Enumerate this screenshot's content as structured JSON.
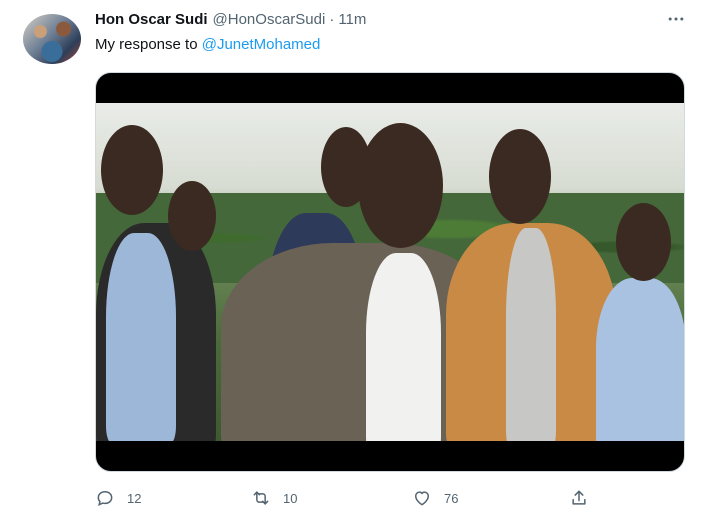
{
  "tweet": {
    "author_name": "Hon Oscar Sudi",
    "author_handle": "@HonOscarSudi",
    "separator": "·",
    "time": "11m",
    "text_prefix": "My response to ",
    "mention": "@JunetMohamed",
    "more_icon": "more-horizontal-icon"
  },
  "media": {
    "type": "video",
    "description_icon": "video-thumbnail"
  },
  "actions": {
    "reply_count": "12",
    "retweet_count": "10",
    "like_count": "76",
    "reply_icon": "reply-icon",
    "retweet_icon": "retweet-icon",
    "like_icon": "heart-icon",
    "share_icon": "share-icon"
  },
  "colors": {
    "accent": "#1d9bf0",
    "secondary_text": "#536471",
    "primary_text": "#0f1419"
  }
}
